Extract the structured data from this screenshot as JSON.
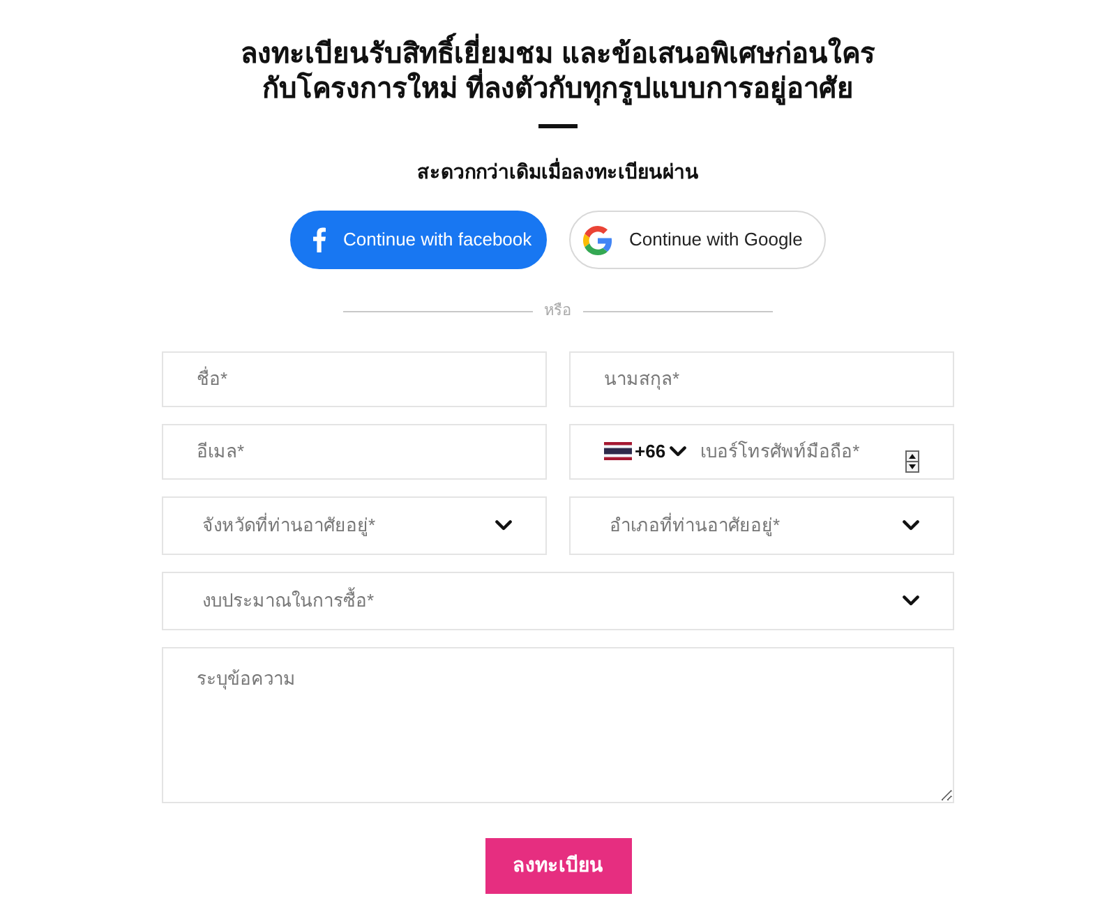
{
  "heading": {
    "lines": [
      "ลงทะเบียนรับสิทธิ์เยี่ยมชม และข้อเสนอพิเศษก่อนใคร",
      "กับโครงการใหม่ ที่ลงตัวกับทุกรูปแบบการอยู่อาศัย"
    ]
  },
  "subtitle": "สะดวกกว่าเดิมเมื่อลงทะเบียนผ่าน",
  "social_buttons": [
    {
      "kind": "facebook",
      "label": "Continue with facebook"
    },
    {
      "kind": "google",
      "label": "Continue with Google"
    }
  ],
  "divider_text": "หรือ",
  "form_rows": [
    [
      {
        "kind": "text",
        "placeholder": "ชื่อ*"
      },
      {
        "kind": "text",
        "placeholder": "นามสกุล*"
      }
    ],
    [
      {
        "kind": "text",
        "placeholder": "อีเมล*"
      },
      {
        "kind": "phone",
        "country_code": "+66",
        "placeholder": "เบอร์โทรศัพท์มือถือ*"
      }
    ],
    [
      {
        "kind": "select",
        "placeholder": "จังหวัดที่ท่านอาศัยอยู่*"
      },
      {
        "kind": "select",
        "placeholder": "อำเภอที่ท่านอาศัยอยู่*"
      }
    ],
    [
      {
        "kind": "select",
        "placeholder": "งบประมาณในการซื้อ*"
      }
    ],
    [
      {
        "kind": "textarea",
        "placeholder": "ระบุข้อความ"
      }
    ]
  ],
  "submit_button": {
    "label": "ลงทะเบียน"
  }
}
